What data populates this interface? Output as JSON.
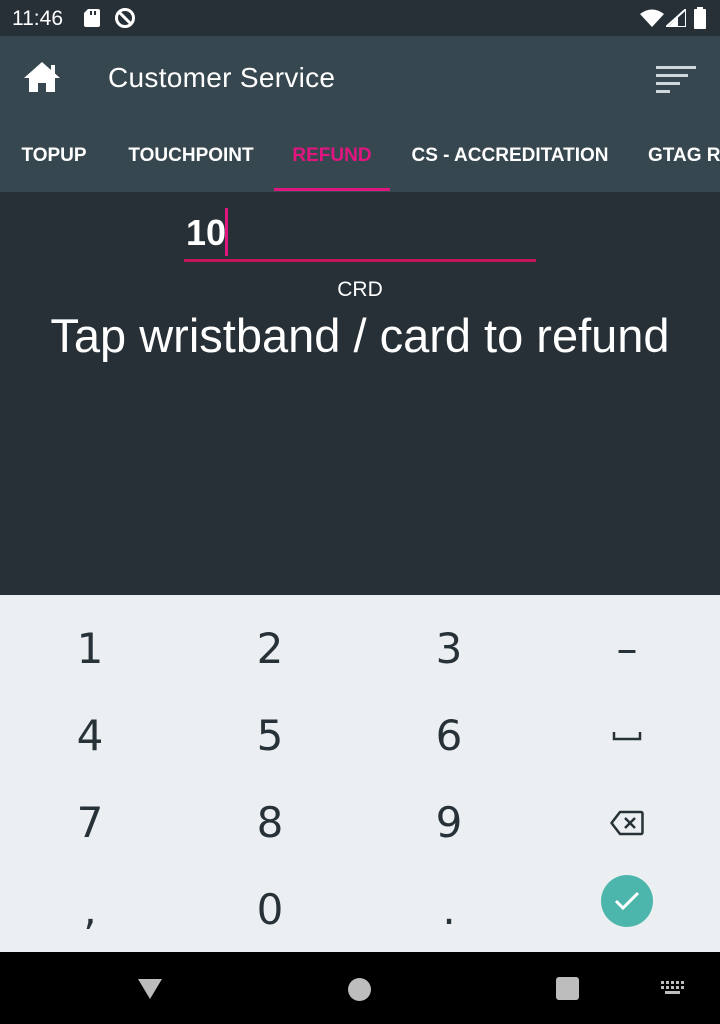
{
  "status_bar": {
    "time": "11:46",
    "icons": [
      "sd-card-icon",
      "sync-disabled-icon",
      "wifi-icon",
      "cell-signal-icon",
      "battery-icon"
    ]
  },
  "app_bar": {
    "title": "Customer Service",
    "home_icon": "home-icon",
    "menu_icon": "sort-menu-icon"
  },
  "tabs": [
    {
      "label": "TOPUP",
      "active": false
    },
    {
      "label": "TOUCHPOINT",
      "active": false
    },
    {
      "label": "REFUND",
      "active": true
    },
    {
      "label": "CS - ACCREDITATION",
      "active": false
    },
    {
      "label": "GTAG R",
      "active": false
    }
  ],
  "refund": {
    "amount": "10",
    "currency": "CRD",
    "instruction": "Tap wristband / card to refund"
  },
  "keypad": {
    "rows": [
      [
        "1",
        "2",
        "3",
        "–"
      ],
      [
        "4",
        "5",
        "6",
        "space-icon"
      ],
      [
        "7",
        "8",
        "9",
        "backspace-icon"
      ],
      [
        ",",
        "0",
        ".",
        "enter-check-icon"
      ]
    ]
  },
  "nav_bar": {
    "icons": [
      "back-icon",
      "home-circle-icon",
      "recents-icon",
      "keyboard-switch-icon"
    ]
  },
  "colors": {
    "status_bar": "#263036",
    "app_bar": "#37474f",
    "content_bg": "#263036",
    "accent": "#e0157f",
    "keyboard_bg": "#eceff1",
    "enter_key": "#4db6ac"
  }
}
